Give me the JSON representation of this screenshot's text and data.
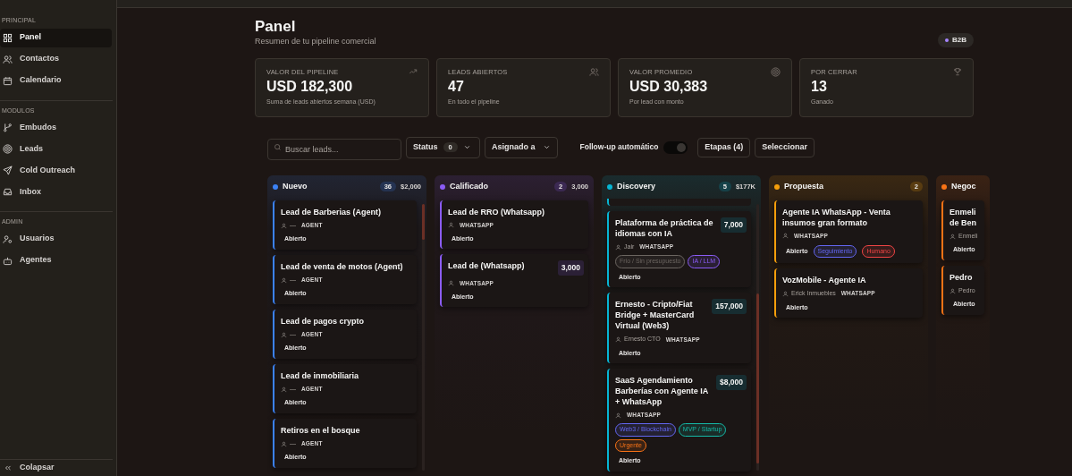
{
  "sidebar": {
    "sections": [
      {
        "label": "PRINCIPAL",
        "items": [
          {
            "label": "Panel",
            "selected": true
          },
          {
            "label": "Contactos",
            "selected": false
          },
          {
            "label": "Calendario",
            "selected": false
          }
        ]
      },
      {
        "label": "MODULOS",
        "items": [
          {
            "label": "Embudos",
            "selected": false
          },
          {
            "label": "Leads",
            "selected": false
          },
          {
            "label": "Cold Outreach",
            "selected": false
          },
          {
            "label": "Inbox",
            "selected": false
          }
        ]
      },
      {
        "label": "ADMIN",
        "items": [
          {
            "label": "Usuarios",
            "selected": false
          },
          {
            "label": "Agentes",
            "selected": false
          }
        ]
      }
    ],
    "collapse": "Colapsar"
  },
  "header": {
    "title": "Panel",
    "subtitle": "Resumen de tu pipeline comercial",
    "badge": "B2B"
  },
  "stats": [
    {
      "label": "VALOR DEL PIPELINE",
      "value": "USD 182,300",
      "note": "Suma de leads abiertos semana (USD)"
    },
    {
      "label": "LEADS ABIERTOS",
      "value": "47",
      "note": "En todo el pipeline"
    },
    {
      "label": "VALOR PROMEDIO",
      "value": "USD 30,383",
      "note": "Por lead con monto"
    },
    {
      "label": "POR CERRAR",
      "value": "13",
      "note": "Ganado"
    }
  ],
  "toolbar": {
    "search": {
      "placeholder": "Buscar leads..."
    },
    "status": {
      "label": "Status",
      "count": "0"
    },
    "assignee": {
      "label": "Asignado a"
    },
    "followup": {
      "label": "Follow-up automático",
      "on": true
    },
    "stages": "Etapas (4)",
    "select": "Seleccionar"
  },
  "columns": [
    {
      "name": "Nuevo",
      "color": "#3b82f6",
      "count": "36",
      "total": "$2,000",
      "scrollbar": true,
      "cut_card_above": false,
      "cards": [
        {
          "title": "Lead de Barberias (Agent)",
          "contact": "—",
          "channel": "AGENT",
          "status": "Abierto"
        },
        {
          "title": "Lead de venta de motos (Agent)",
          "contact": "—",
          "channel": "AGENT",
          "status": "Abierto"
        },
        {
          "title": "Lead de pagos crypto",
          "contact": "—",
          "channel": "AGENT",
          "status": "Abierto"
        },
        {
          "title": "Lead de inmobiliaria",
          "contact": "—",
          "channel": "AGENT",
          "status": "Abierto"
        },
        {
          "title": "Retiros en el bosque",
          "contact": "—",
          "channel": "AGENT",
          "status": "Abierto"
        }
      ]
    },
    {
      "name": "Calificado",
      "color": "#8b5cf6",
      "count": "2",
      "total": "3,000",
      "scrollbar": false,
      "cut_card_above": false,
      "cards": [
        {
          "title": "Lead de RRO (Whatsapp)",
          "channel": "WHATSAPP",
          "status": "Abierto"
        },
        {
          "title": "Lead de (Whatsapp)",
          "amount": "3,000",
          "channel": "WHATSAPP",
          "status": "Abierto"
        }
      ]
    },
    {
      "name": "Discovery",
      "color": "#06b6d4",
      "count": "5",
      "total": "$177K",
      "scrollbar": true,
      "cut_card_above": true,
      "cards": [
        {
          "title": "Plataforma de práctica de idiomas con IA",
          "amount": "7,000",
          "contact": "Jair",
          "channel": "WHATSAPP",
          "tags": [
            {
              "label": "Frio / Sin presupuesto",
              "color": "#6b6560"
            },
            {
              "label": "IA / LLM",
              "color": "#8b5cf6"
            }
          ],
          "status": "Abierto"
        },
        {
          "title": "Ernesto - Cripto/Fiat Bridge + MasterCard Virtual (Web3)",
          "amount": "157,000",
          "contact": "Ernesto CTO",
          "channel": "WHATSAPP",
          "status": "Abierto"
        },
        {
          "title": "SaaS Agendamiento Barberías con Agente IA + WhatsApp",
          "amount": "$8,000",
          "channel": "WHATSAPP",
          "tags": [
            {
              "label": "Web3 / Blockchain",
              "color": "#6366f1"
            },
            {
              "label": "MVP / Startup",
              "color": "#14b8a6"
            },
            {
              "label": "Urgente",
              "color": "#f97316"
            }
          ],
          "status": "Abierto"
        }
      ]
    },
    {
      "name": "Propuesta",
      "color": "#f59e0b",
      "count": "2",
      "scrollbar": false,
      "cut_card_above": false,
      "cards": [
        {
          "title": "Agente IA WhatsApp - Venta insumos gran formato",
          "channel": "WHATSAPP",
          "status": "Abierto",
          "status_tags": [
            {
              "label": "Seguimiento",
              "color": "#6366f1"
            },
            {
              "label": "Humano",
              "color": "#ef4444"
            }
          ]
        },
        {
          "title": "VozMobile - Agente IA",
          "contact": "Erick Inmuebles",
          "channel": "WHATSAPP",
          "status": "Abierto"
        }
      ]
    },
    {
      "name": "Negoc",
      "color": "#f97316",
      "scrollbar": false,
      "cut_card_above": false,
      "cards": [
        {
          "title": "Enmeli\nde Ben",
          "contact": "Enmeli",
          "status": "Abierto"
        },
        {
          "title": "Pedro",
          "contact": "Pedro",
          "status": "Abierto"
        }
      ]
    }
  ]
}
